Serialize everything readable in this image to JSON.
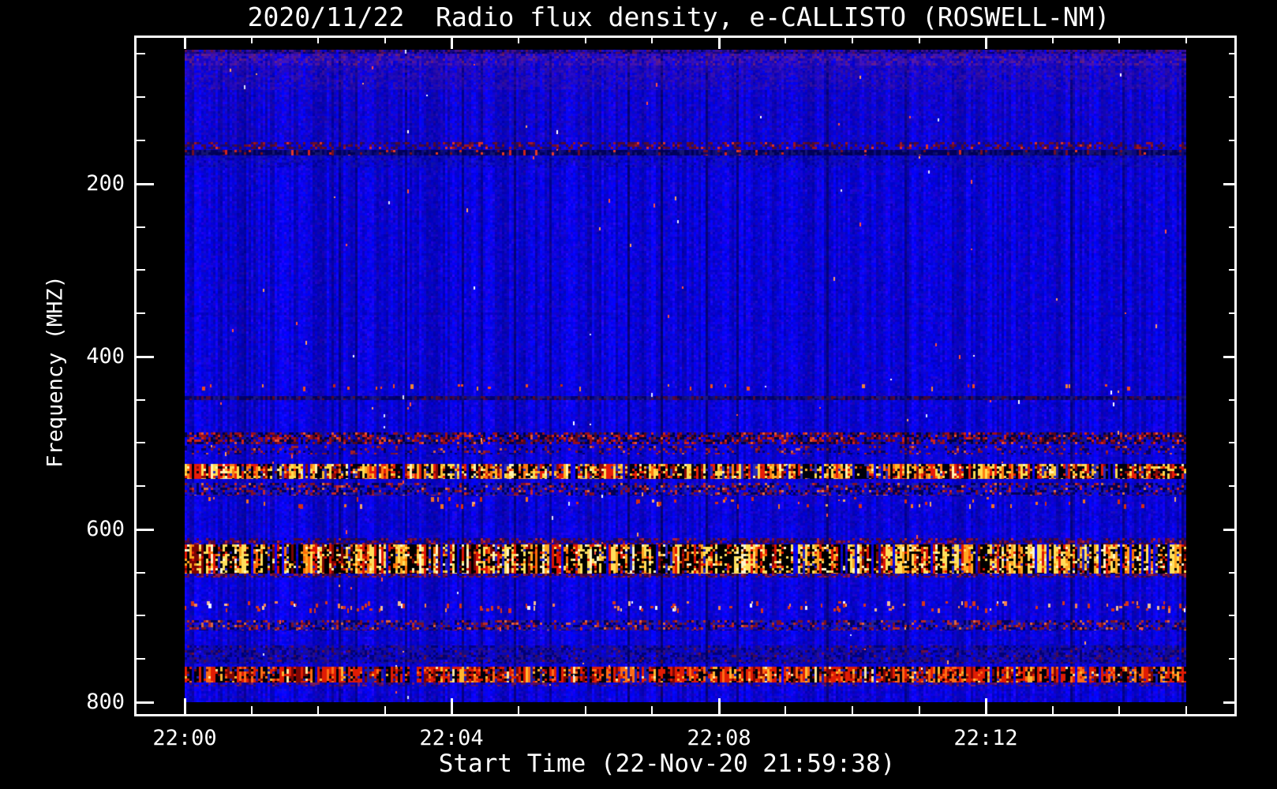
{
  "page": {
    "background_color": "#000000",
    "text_color": "#ffffff"
  },
  "chart_data": {
    "type": "heatmap",
    "title": "2020/11/22  Radio flux density, e-CALLISTO (ROSWELL-NM)",
    "xlabel": "Start Time (22-Nov-20 21:59:38)",
    "ylabel": "Frequency (MHZ)",
    "legend": "none",
    "grid": "off",
    "x_axis": {
      "major_ticks": [
        {
          "label": "22:00",
          "minute": 0
        },
        {
          "label": "22:04",
          "minute": 4
        },
        {
          "label": "22:08",
          "minute": 8
        },
        {
          "label": "22:12",
          "minute": 12
        }
      ],
      "minor_tick_interval_min": 1,
      "minor_tick_count": 16,
      "data_span_minutes": [
        0,
        15
      ]
    },
    "y_axis": {
      "unit": "MHZ",
      "major_ticks": [
        200,
        400,
        600,
        800
      ],
      "minor_tick_interval": 50,
      "tick_range": [
        50,
        800
      ],
      "data_freq_range": [
        45,
        800
      ],
      "direction": "frequency-increases-downward"
    },
    "colors": {
      "frame": "#ffffff",
      "plot_background_blue": "#1414ee",
      "outer_background": "#000000"
    },
    "spectrogram": {
      "background": {
        "blue_base": 200,
        "blue_jitter": 52,
        "red_jitter": 42,
        "green_jitter": 16,
        "column_dark_p": 0.05
      },
      "speck_p": 0.0012,
      "speck_colors": [
        [
          "#ff5040",
          2
        ],
        [
          "#ffffff",
          0.6
        ],
        [
          "#ffa060",
          1
        ],
        [
          "#e0e6ff",
          0.6
        ]
      ],
      "bands": [
        {
          "name": "noise-top-checker",
          "f": [
            45,
            50
          ],
          "style": "mottle",
          "alpha": 0.85,
          "colors": [
            [
              "#1a0870",
              3
            ],
            [
              "#000050",
              2
            ],
            [
              "#4a1080",
              2
            ],
            [
              "#2a0cb0",
              2
            ],
            [
              "#6a1030",
              1
            ],
            [
              null,
              1
            ]
          ]
        },
        {
          "name": "noise-red-purple",
          "f": [
            50,
            63
          ],
          "style": "mottle",
          "alpha": 0.6,
          "colors": [
            [
              "#4a16b4",
              3
            ],
            [
              "#6a2090",
              2
            ],
            [
              "#8c2862",
              1
            ],
            [
              "#2a0aa4",
              3
            ],
            [
              "#a03050",
              0.7
            ],
            [
              null,
              3
            ]
          ]
        },
        {
          "name": "noise-purple",
          "f": [
            63,
            92
          ],
          "style": "mottle",
          "alpha": 0.5,
          "colors": [
            [
              "#44129c",
              3
            ],
            [
              "#2c0c9c",
              3
            ],
            [
              "#601c84",
              1
            ],
            [
              null,
              4
            ]
          ]
        },
        {
          "name": "noise-faint",
          "f": [
            92,
            150
          ],
          "style": "mottle",
          "alpha": 0.3,
          "colors": [
            [
              "#3c1090",
              2
            ],
            [
              "#28088c",
              2
            ],
            [
              null,
              7
            ]
          ]
        },
        {
          "name": "rfi-dashes-152",
          "f": [
            152,
            160
          ],
          "style": "speckle",
          "alpha": 0.85,
          "colors": [
            [
              "#5c0c18",
              2
            ],
            [
              "#7c1010",
              1
            ],
            [
              "#b41808",
              0.5
            ],
            [
              "#ff3810",
              0.3
            ],
            [
              "#1a0a60",
              1.5
            ],
            [
              null,
              6
            ]
          ]
        },
        {
          "name": "rfi-line-163",
          "f": [
            161,
            167
          ],
          "style": "streaks",
          "alpha": 0.9,
          "skip": 0,
          "colors": [
            [
              "#000050",
              5
            ],
            [
              "#0a0a78",
              3
            ],
            [
              "#16166a",
              2
            ],
            [
              "#801010",
              0.4
            ],
            [
              "#e82808",
              0.3
            ],
            [
              "#ff4018",
              0.2
            ]
          ]
        },
        {
          "name": "mottle-below-line",
          "f": [
            167,
            181
          ],
          "style": "mottle",
          "alpha": 0.5,
          "colors": [
            [
              "#0c0cb8",
              3
            ],
            [
              "#1e1e8e",
              2
            ],
            [
              "#000078",
              2
            ],
            [
              null,
              4
            ]
          ]
        },
        {
          "name": "faint-line-350",
          "f": [
            349,
            353
          ],
          "style": "mottle",
          "alpha": 0.28,
          "colors": [
            [
              "#000090",
              3
            ],
            [
              null,
              2
            ]
          ]
        },
        {
          "name": "sparse-ticks-435",
          "f": [
            432,
            438
          ],
          "style": "sparse",
          "p": 0.02,
          "colors": [
            [
              "#ff5010",
              2
            ],
            [
              "#ff8c28",
              1
            ],
            [
              "#d02808",
              1
            ]
          ]
        },
        {
          "name": "rfi-line-448",
          "f": [
            446,
            450
          ],
          "style": "streaks",
          "alpha": 0.8,
          "skip": 0,
          "colors": [
            [
              "#000058",
              4
            ],
            [
              "#101070",
              3
            ],
            [
              "#4c0820",
              1.5
            ],
            [
              "#660c14",
              1
            ],
            [
              "#201a80",
              2
            ]
          ]
        },
        {
          "name": "band-495",
          "f": [
            488,
            501
          ],
          "style": "speckle",
          "alpha": 0.9,
          "colors": [
            [
              "#000030",
              3
            ],
            [
              "#5c0808",
              2
            ],
            [
              "#a81008",
              2
            ],
            [
              "#e82808",
              1.2
            ],
            [
              "#ff6020",
              0.5
            ],
            [
              "#181880",
              1.5
            ],
            [
              null,
              4
            ]
          ]
        },
        {
          "name": "sparse-508",
          "f": [
            503,
            513
          ],
          "style": "speckle",
          "alpha": 0.8,
          "colors": [
            [
              "#901808",
              1
            ],
            [
              "#c82808",
              0.7
            ],
            [
              "#ff7830",
              0.25
            ],
            [
              "#000048",
              1.5
            ],
            [
              null,
              9
            ]
          ]
        },
        {
          "name": "band-533-bright",
          "f": [
            524,
            542
          ],
          "style": "streaks",
          "alpha": 1,
          "colors": [
            [
              "#00000c",
              5
            ],
            [
              "#ffdc50",
              3
            ],
            [
              "#ffb428",
              1.5
            ],
            [
              "#ff7c10",
              1.5
            ],
            [
              "#e81c08",
              2.5
            ],
            [
              "#8c0808",
              1.5
            ],
            [
              "#2a2ab4",
              1.2
            ],
            [
              "#fff4b0",
              0.7
            ]
          ]
        },
        {
          "name": "band-553",
          "f": [
            546,
            561
          ],
          "style": "speckle",
          "alpha": 0.85,
          "colors": [
            [
              "#000040",
              3
            ],
            [
              "#981408",
              1.5
            ],
            [
              "#e83010",
              0.8
            ],
            [
              "#ff8830",
              0.3
            ],
            [
              "#2020a8",
              2
            ],
            [
              null,
              5
            ]
          ]
        },
        {
          "name": "sparse-567",
          "f": [
            563,
            572
          ],
          "style": "sparse",
          "p": 0.02,
          "colors": [
            [
              "#ff7818",
              1
            ],
            [
              "#e03008",
              1
            ],
            [
              "#ffb060",
              0.4
            ]
          ]
        },
        {
          "name": "faint-586",
          "f": [
            578,
            594
          ],
          "style": "mottle",
          "alpha": 0.2,
          "colors": [
            [
              "#000080",
              2
            ],
            [
              "#202090",
              1
            ],
            [
              null,
              5
            ]
          ]
        },
        {
          "name": "fringe-613",
          "f": [
            610,
            617
          ],
          "style": "speckle",
          "alpha": 0.75,
          "colors": [
            [
              "#6c0a08",
              2
            ],
            [
              "#a81408",
              1
            ],
            [
              "#e83008",
              0.5
            ],
            [
              "#100a50",
              2
            ],
            [
              null,
              4
            ]
          ]
        },
        {
          "name": "band-634-strongest",
          "f": [
            617,
            651
          ],
          "style": "streaks",
          "alpha": 1,
          "colors": [
            [
              "#000000",
              7
            ],
            [
              "#ffe05c",
              4
            ],
            [
              "#fff6c8",
              1.6
            ],
            [
              "#ffa820",
              2
            ],
            [
              "#ff6c08",
              1.4
            ],
            [
              "#de1404",
              2.2
            ],
            [
              "#7a0404",
              1.2
            ],
            [
              "#2222c0",
              0.9
            ]
          ]
        },
        {
          "name": "fringe-653",
          "f": [
            651,
            656
          ],
          "style": "speckle",
          "alpha": 0.7,
          "colors": [
            [
              "#8c1008",
              2
            ],
            [
              "#d02808",
              1
            ],
            [
              "#400808",
              1.5
            ],
            [
              null,
              4
            ]
          ]
        },
        {
          "name": "sparse-688",
          "f": [
            683,
            692
          ],
          "style": "sparse",
          "p": 0.05,
          "colors": [
            [
              "#e03810",
              2
            ],
            [
              "#ff8848",
              1
            ],
            [
              "#ffffff",
              0.25
            ],
            [
              "#ffc890",
              0.5
            ]
          ]
        },
        {
          "name": "band-711",
          "f": [
            705,
            717
          ],
          "style": "speckle",
          "alpha": 0.85,
          "colors": [
            [
              "#000048",
              2.5
            ],
            [
              "#8c1408",
              1.6
            ],
            [
              "#d83008",
              1
            ],
            [
              "#ff7828",
              0.4
            ],
            [
              "#242498",
              2
            ],
            [
              null,
              4.5
            ]
          ]
        },
        {
          "name": "band-745-dark",
          "f": [
            734,
            755
          ],
          "style": "mottle",
          "alpha": 0.7,
          "colors": [
            [
              "#000054",
              3
            ],
            [
              "#1a1078",
              2.5
            ],
            [
              "#3c1268",
              1.2
            ],
            [
              "#0a0ab8",
              2.5
            ],
            [
              "#58101c",
              0.6
            ],
            [
              "#901408",
              0.3
            ],
            [
              null,
              3
            ]
          ]
        },
        {
          "name": "band-768-red",
          "f": [
            759,
            777
          ],
          "style": "streaks",
          "alpha": 1,
          "colors": [
            [
              "#00000a",
              4.5
            ],
            [
              "#e01c04",
              4
            ],
            [
              "#ff6c14",
              2.2
            ],
            [
              "#ffb830",
              0.9
            ],
            [
              "#7c0604",
              2
            ],
            [
              "#ffe9a0",
              0.35
            ],
            [
              "#1c1cb0",
              1.4
            ]
          ]
        },
        {
          "name": "fringe-780",
          "f": [
            777,
            782
          ],
          "style": "speckle",
          "alpha": 0.55,
          "colors": [
            [
              "#901808",
              1.5
            ],
            [
              "#d03008",
              0.6
            ],
            [
              "#3c0810",
              1
            ],
            [
              null,
              6
            ]
          ]
        }
      ]
    }
  }
}
